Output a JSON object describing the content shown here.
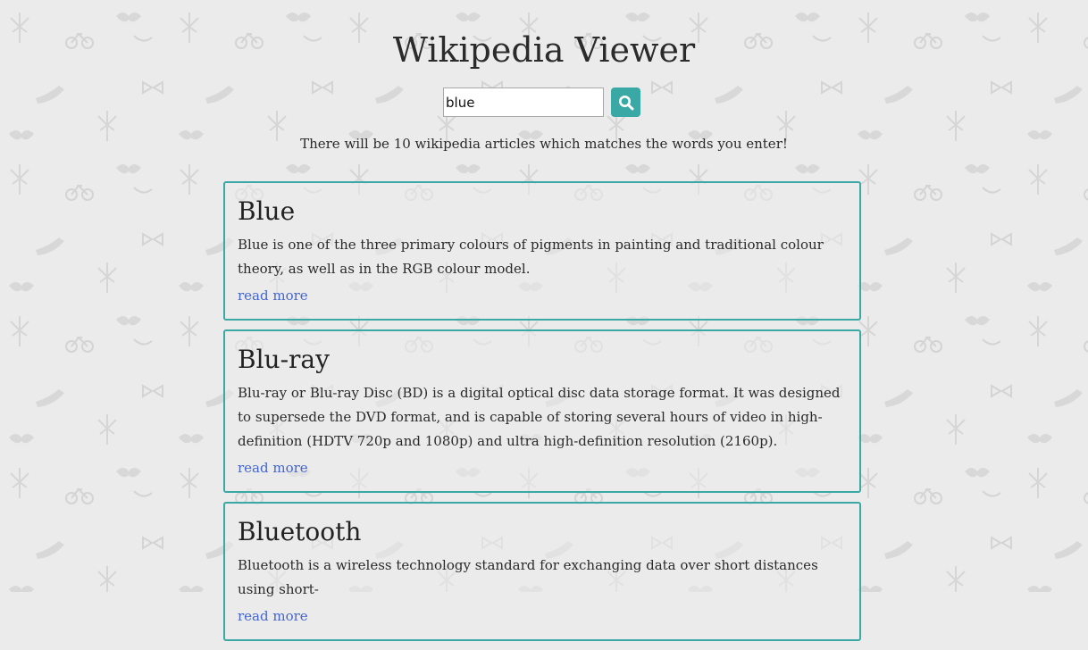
{
  "header": {
    "title": "Wikipedia Viewer"
  },
  "search": {
    "value": "blue",
    "button_icon": "search-icon"
  },
  "hint_text": "There will be 10 wikipedia articles which matches the words you enter!",
  "results": [
    {
      "title": "Blue",
      "snippet": "Blue is one of the three primary colours of pigments in painting and traditional colour theory, as well as in the RGB colour model.",
      "link_label": "read more"
    },
    {
      "title": "Blu-ray",
      "snippet": "Blu-ray or Blu-ray Disc (BD) is a digital optical disc data storage format. It was designed to supersede the DVD format, and is capable of storing several hours of video in high-definition (HDTV 720p and 1080p) and ultra high-definition resolution (2160p).",
      "link_label": "read more"
    },
    {
      "title": "Bluetooth",
      "snippet": "Bluetooth is a wireless technology standard for exchanging data over short distances using short-",
      "link_label": "read more"
    }
  ],
  "colors": {
    "accent": "#3aa8a5",
    "link": "#4466cc",
    "background": "#ebebeb"
  }
}
